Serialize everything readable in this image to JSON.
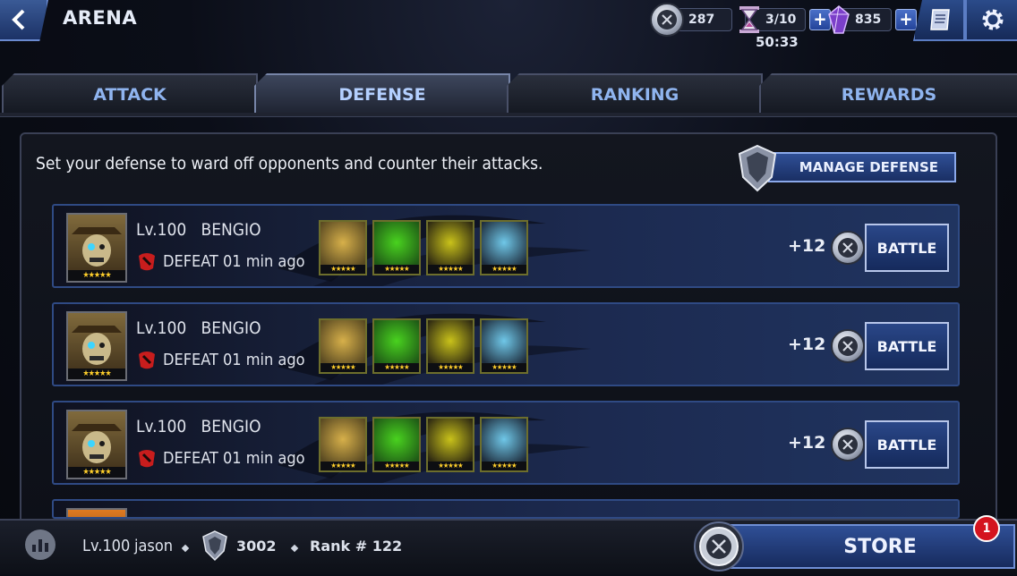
{
  "header": {
    "title": "ARENA",
    "arena_coins": "287",
    "energy": "3/10",
    "energy_timer": "50:33",
    "crystals": "835"
  },
  "tabs": [
    {
      "label": "ATTACK",
      "active": false
    },
    {
      "label": "DEFENSE",
      "active": true
    },
    {
      "label": "RANKING",
      "active": false
    },
    {
      "label": "REWARDS",
      "active": false
    }
  ],
  "defense": {
    "description": "Set your defense to ward off opponents and counter their attacks.",
    "manage_label": "MANAGE DEFENSE"
  },
  "rows": [
    {
      "level": "Lv.100",
      "name": "BENGIO",
      "result": "DEFEAT",
      "time": "01 min ago",
      "points": "+12",
      "battle_label": "BATTLE",
      "stars": "★★★★★"
    },
    {
      "level": "Lv.100",
      "name": "BENGIO",
      "result": "DEFEAT",
      "time": "01 min ago",
      "points": "+12",
      "battle_label": "BATTLE",
      "stars": "★★★★★"
    },
    {
      "level": "Lv.100",
      "name": "BENGIO",
      "result": "DEFEAT",
      "time": "01 min ago",
      "points": "+12",
      "battle_label": "BATTLE",
      "stars": "★★★★★"
    }
  ],
  "footer": {
    "level": "Lv.100",
    "username": "jason",
    "score": "3002",
    "rank": "Rank # 122",
    "store_label": "STORE",
    "store_badge": "1"
  },
  "colors": {
    "accent_blue": "#2f4f96",
    "tab_text": "#8fb4ef",
    "star": "#ffcf2b",
    "badge_red": "#d4141e"
  }
}
